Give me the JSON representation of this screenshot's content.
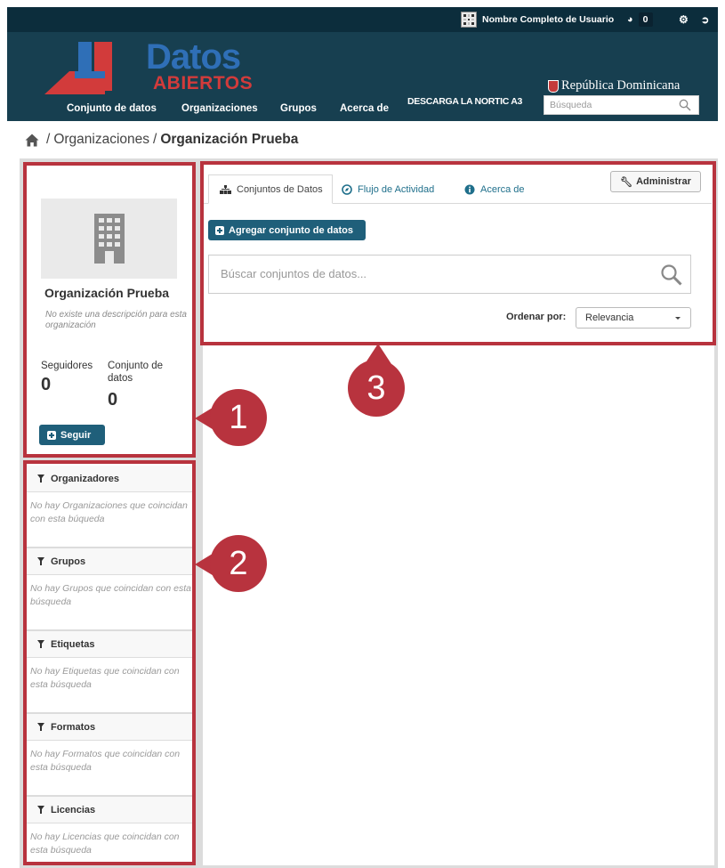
{
  "header": {
    "user_name": "Nombre Completo de Usuario",
    "dashboard_count": "0",
    "logo_main": "Datos",
    "logo_sub": "ABIERTOS",
    "nav": [
      "Conjunto de datos",
      "Organizaciones",
      "Grupos",
      "Acerca de"
    ],
    "nortic_link": "DESCARGA LA NORTIC A3",
    "country": "República Dominicana",
    "search_placeholder": "Búsqueda"
  },
  "breadcrumb": {
    "separator": "/",
    "parent": "Organizaciones",
    "current": "Organización Prueba"
  },
  "organization": {
    "name": "Organización Prueba",
    "description": "No existe una descripción para esta organización",
    "followers_label": "Seguidores",
    "followers_value": "0",
    "datasets_label": "Conjunto de datos",
    "datasets_value": "0",
    "follow_button": "Seguir"
  },
  "facets": [
    {
      "title": "Organizadores",
      "empty": "No hay Organizaciones que coincidan con esta búqueda"
    },
    {
      "title": "Grupos",
      "empty": "No hay Grupos que coincidan con esta búsqueda"
    },
    {
      "title": "Etiquetas",
      "empty": "No hay Etiquetas que coincidan con esta búsqueda"
    },
    {
      "title": "Formatos",
      "empty": "No hay Formatos que coincidan con esta búsqueda"
    },
    {
      "title": "Licencias",
      "empty": "No hay Licencias que coincidan con esta búsqueda"
    }
  ],
  "content": {
    "tabs": [
      "Conjuntos de Datos",
      "Flujo de Actividad",
      "Acerca de"
    ],
    "admin_button": "Administrar",
    "add_dataset_button": "Agregar conjunto de datos",
    "search_placeholder": "Búscar conjuntos de datos...",
    "sort_label": "Ordenar por:",
    "sort_value": "Relevancia"
  },
  "annotations": [
    "1",
    "2",
    "3"
  ],
  "colors": {
    "annotation_red": "#b8333e",
    "header_dark": "#0c2d3c",
    "masthead": "#173f50",
    "button_teal": "#1f5f7a",
    "link": "#1f6f8b"
  }
}
